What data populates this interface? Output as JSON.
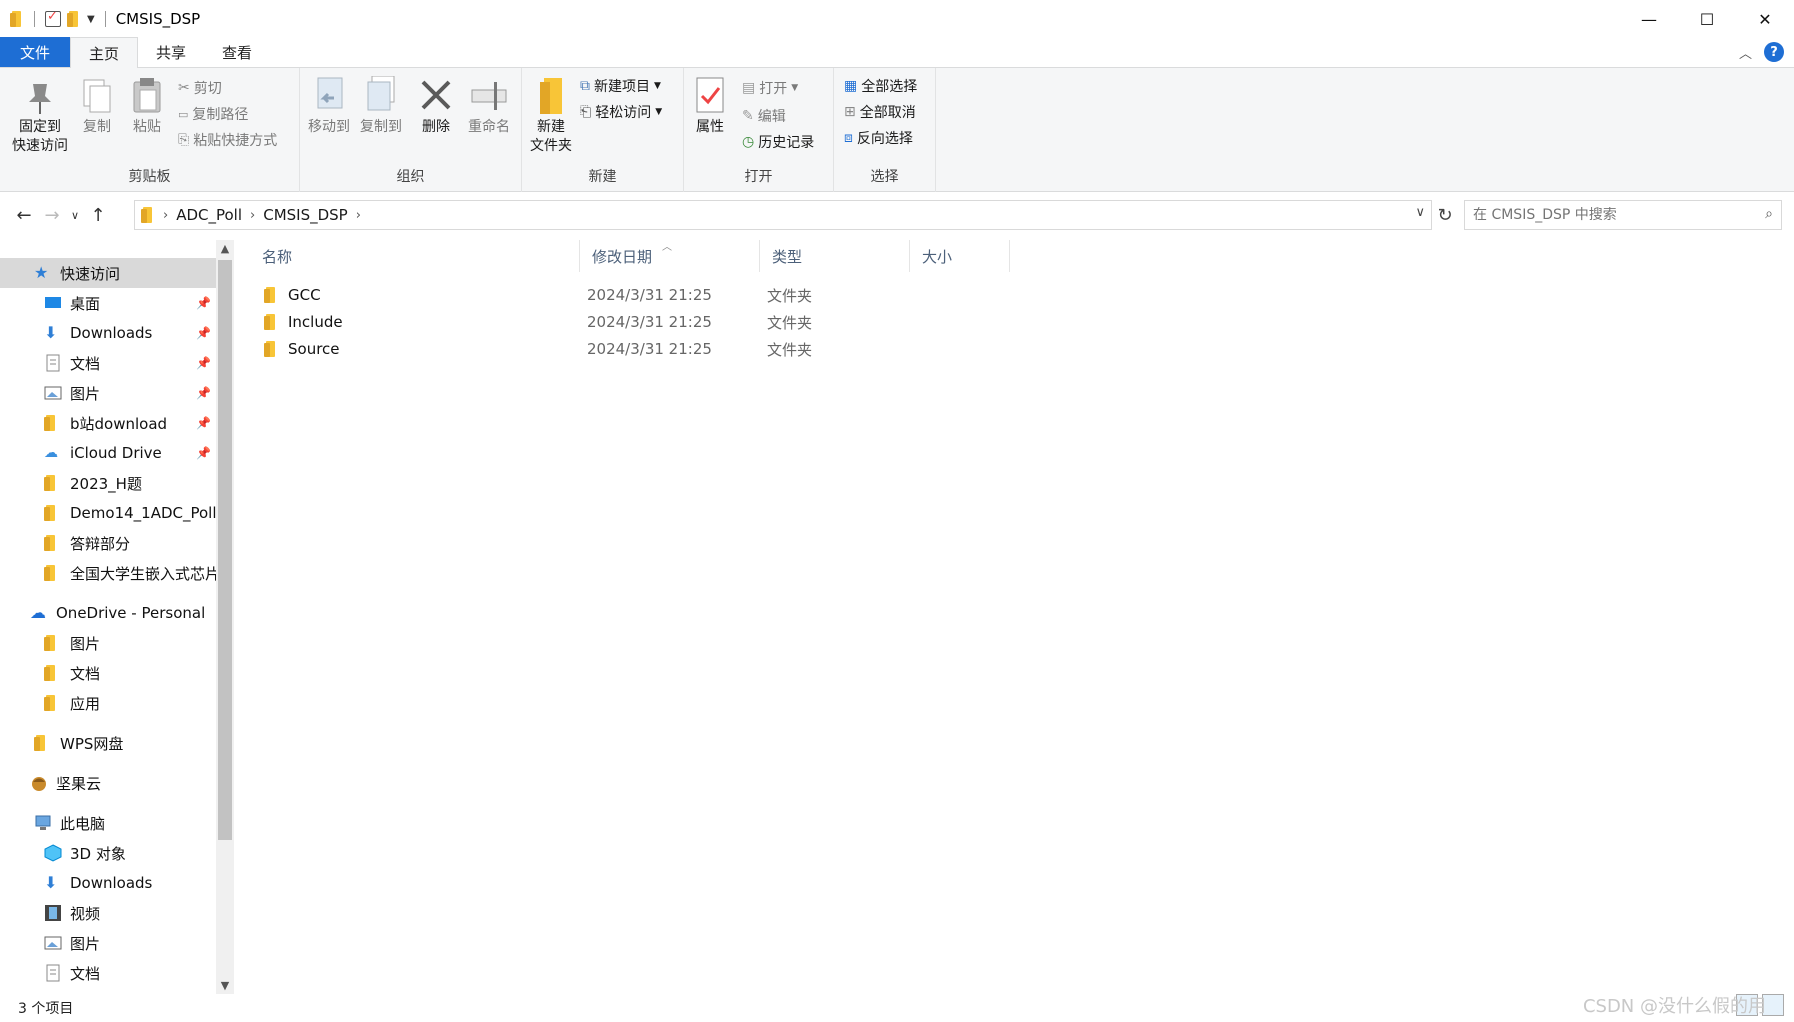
{
  "window": {
    "title": "CMSIS_DSP"
  },
  "tabs": [
    {
      "label": "文件"
    },
    {
      "label": "主页"
    },
    {
      "label": "共享"
    },
    {
      "label": "查看"
    }
  ],
  "ribbon": {
    "clipboard": {
      "label": "剪贴板",
      "pin": "固定到\n快速访问",
      "copy": "复制",
      "paste": "粘贴",
      "cut": "剪切",
      "copy_path": "复制路径",
      "paste_shortcut": "粘贴快捷方式"
    },
    "organize": {
      "label": "组织",
      "move_to": "移动到",
      "copy_to": "复制到",
      "delete": "删除",
      "rename": "重命名"
    },
    "new": {
      "label": "新建",
      "new_folder": "新建\n文件夹",
      "new_item": "新建项目",
      "easy_access": "轻松访问"
    },
    "open": {
      "label": "打开",
      "properties": "属性",
      "open": "打开",
      "edit": "编辑",
      "history": "历史记录"
    },
    "select": {
      "label": "选择",
      "select_all": "全部选择",
      "select_none": "全部取消",
      "invert": "反向选择"
    }
  },
  "address": {
    "crumbs": [
      "ADC_Poll",
      "CMSIS_DSP"
    ],
    "search_placeholder": "在 CMSIS_DSP 中搜索"
  },
  "nav": {
    "quick_access": "快速访问",
    "items": [
      {
        "label": "桌面",
        "pinned": true
      },
      {
        "label": "Downloads",
        "pinned": true
      },
      {
        "label": "文档",
        "pinned": true
      },
      {
        "label": "图片",
        "pinned": true
      },
      {
        "label": "b站download",
        "pinned": true
      },
      {
        "label": "iCloud Drive",
        "pinned": true
      },
      {
        "label": "2023_H题"
      },
      {
        "label": "Demo14_1ADC_Poll"
      },
      {
        "label": "答辩部分"
      },
      {
        "label": "全国大学生嵌入式芯片"
      }
    ],
    "onedrive": "OneDrive - Personal",
    "onedrive_items": [
      "图片",
      "文档",
      "应用"
    ],
    "wps": "WPS网盘",
    "jianguoyun": "坚果云",
    "this_pc": "此电脑",
    "pc_items": [
      "3D 对象",
      "Downloads",
      "视频",
      "图片",
      "文档"
    ]
  },
  "columns": {
    "name": "名称",
    "date": "修改日期",
    "type": "类型",
    "size": "大小"
  },
  "files": [
    {
      "name": "GCC",
      "date": "2024/3/31 21:25",
      "type": "文件夹"
    },
    {
      "name": "Include",
      "date": "2024/3/31 21:25",
      "type": "文件夹"
    },
    {
      "name": "Source",
      "date": "2024/3/31 21:25",
      "type": "文件夹"
    }
  ],
  "status": {
    "count": "3 个项目"
  },
  "watermark": "CSDN @没什么假的用",
  "colors": {
    "accent": "#1e6ed4",
    "folder": "#f8c537",
    "selected": "#cce8ff"
  }
}
